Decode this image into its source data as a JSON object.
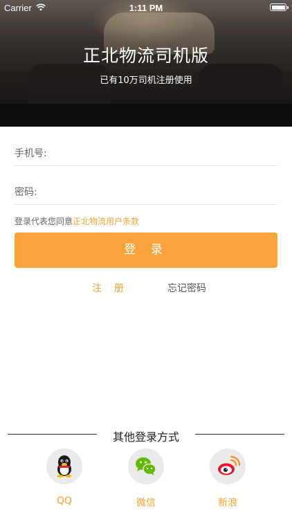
{
  "status_bar": {
    "carrier": "Carrier",
    "time": "1:11 PM"
  },
  "header": {
    "title": "正北物流司机版",
    "subtitle": "已有10万司机注册使用"
  },
  "form": {
    "phone_label": "手机号:",
    "phone_value": "",
    "password_label": "密码:",
    "password_value": ""
  },
  "agreement": {
    "prefix": "登录代表您同意",
    "link": "正北物流用户条款"
  },
  "login_button": "登 录",
  "links": {
    "register": "注册",
    "forgot_password": "忘记密码"
  },
  "other_login": {
    "title": "其他登录方式",
    "options": [
      {
        "label": "QQ",
        "icon": "qq-icon"
      },
      {
        "label": "微信",
        "icon": "wechat-icon"
      },
      {
        "label": "新浪",
        "icon": "weibo-icon"
      }
    ]
  },
  "colors": {
    "accent": "#f9a43b",
    "link": "#f7a134",
    "text": "#666666"
  }
}
